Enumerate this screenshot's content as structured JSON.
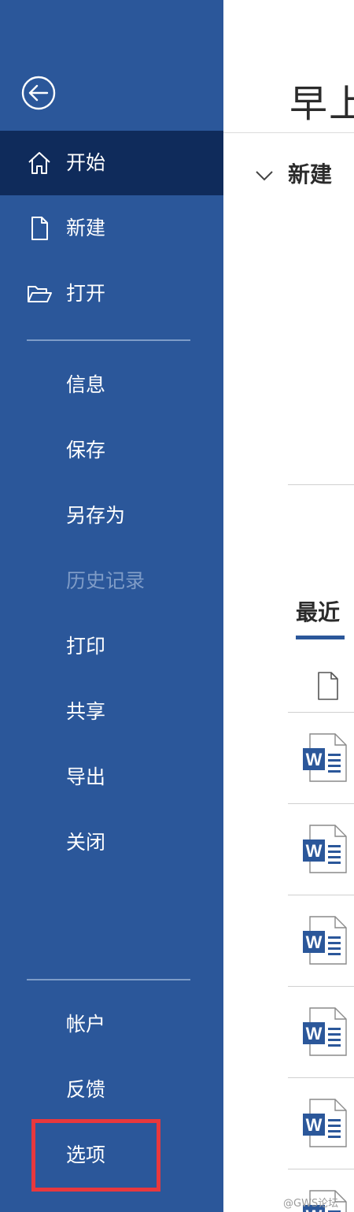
{
  "sidebar": {
    "back_icon": "back-arrow-circle-icon",
    "items_top": [
      {
        "label": "开始",
        "icon": "home-icon",
        "active": true
      },
      {
        "label": "新建",
        "icon": "new-document-icon"
      },
      {
        "label": "打开",
        "icon": "open-folder-icon"
      }
    ],
    "items_middle": [
      {
        "label": "信息"
      },
      {
        "label": "保存"
      },
      {
        "label": "另存为"
      },
      {
        "label": "历史记录",
        "disabled": true
      },
      {
        "label": "打印"
      },
      {
        "label": "共享"
      },
      {
        "label": "导出"
      },
      {
        "label": "关闭"
      }
    ],
    "items_bottom": [
      {
        "label": "帐户"
      },
      {
        "label": "反馈"
      },
      {
        "label": "选项",
        "highlighted": true
      }
    ]
  },
  "main": {
    "greeting": "早上",
    "new_section": {
      "heading": "新建",
      "toggle_icon": "chevron-down-icon"
    },
    "recent_tab": "最近",
    "column_icon": "document-icon",
    "file_icon": "word-document-icon",
    "recent_file_count": 6
  },
  "watermark": "@GWS论坛"
}
